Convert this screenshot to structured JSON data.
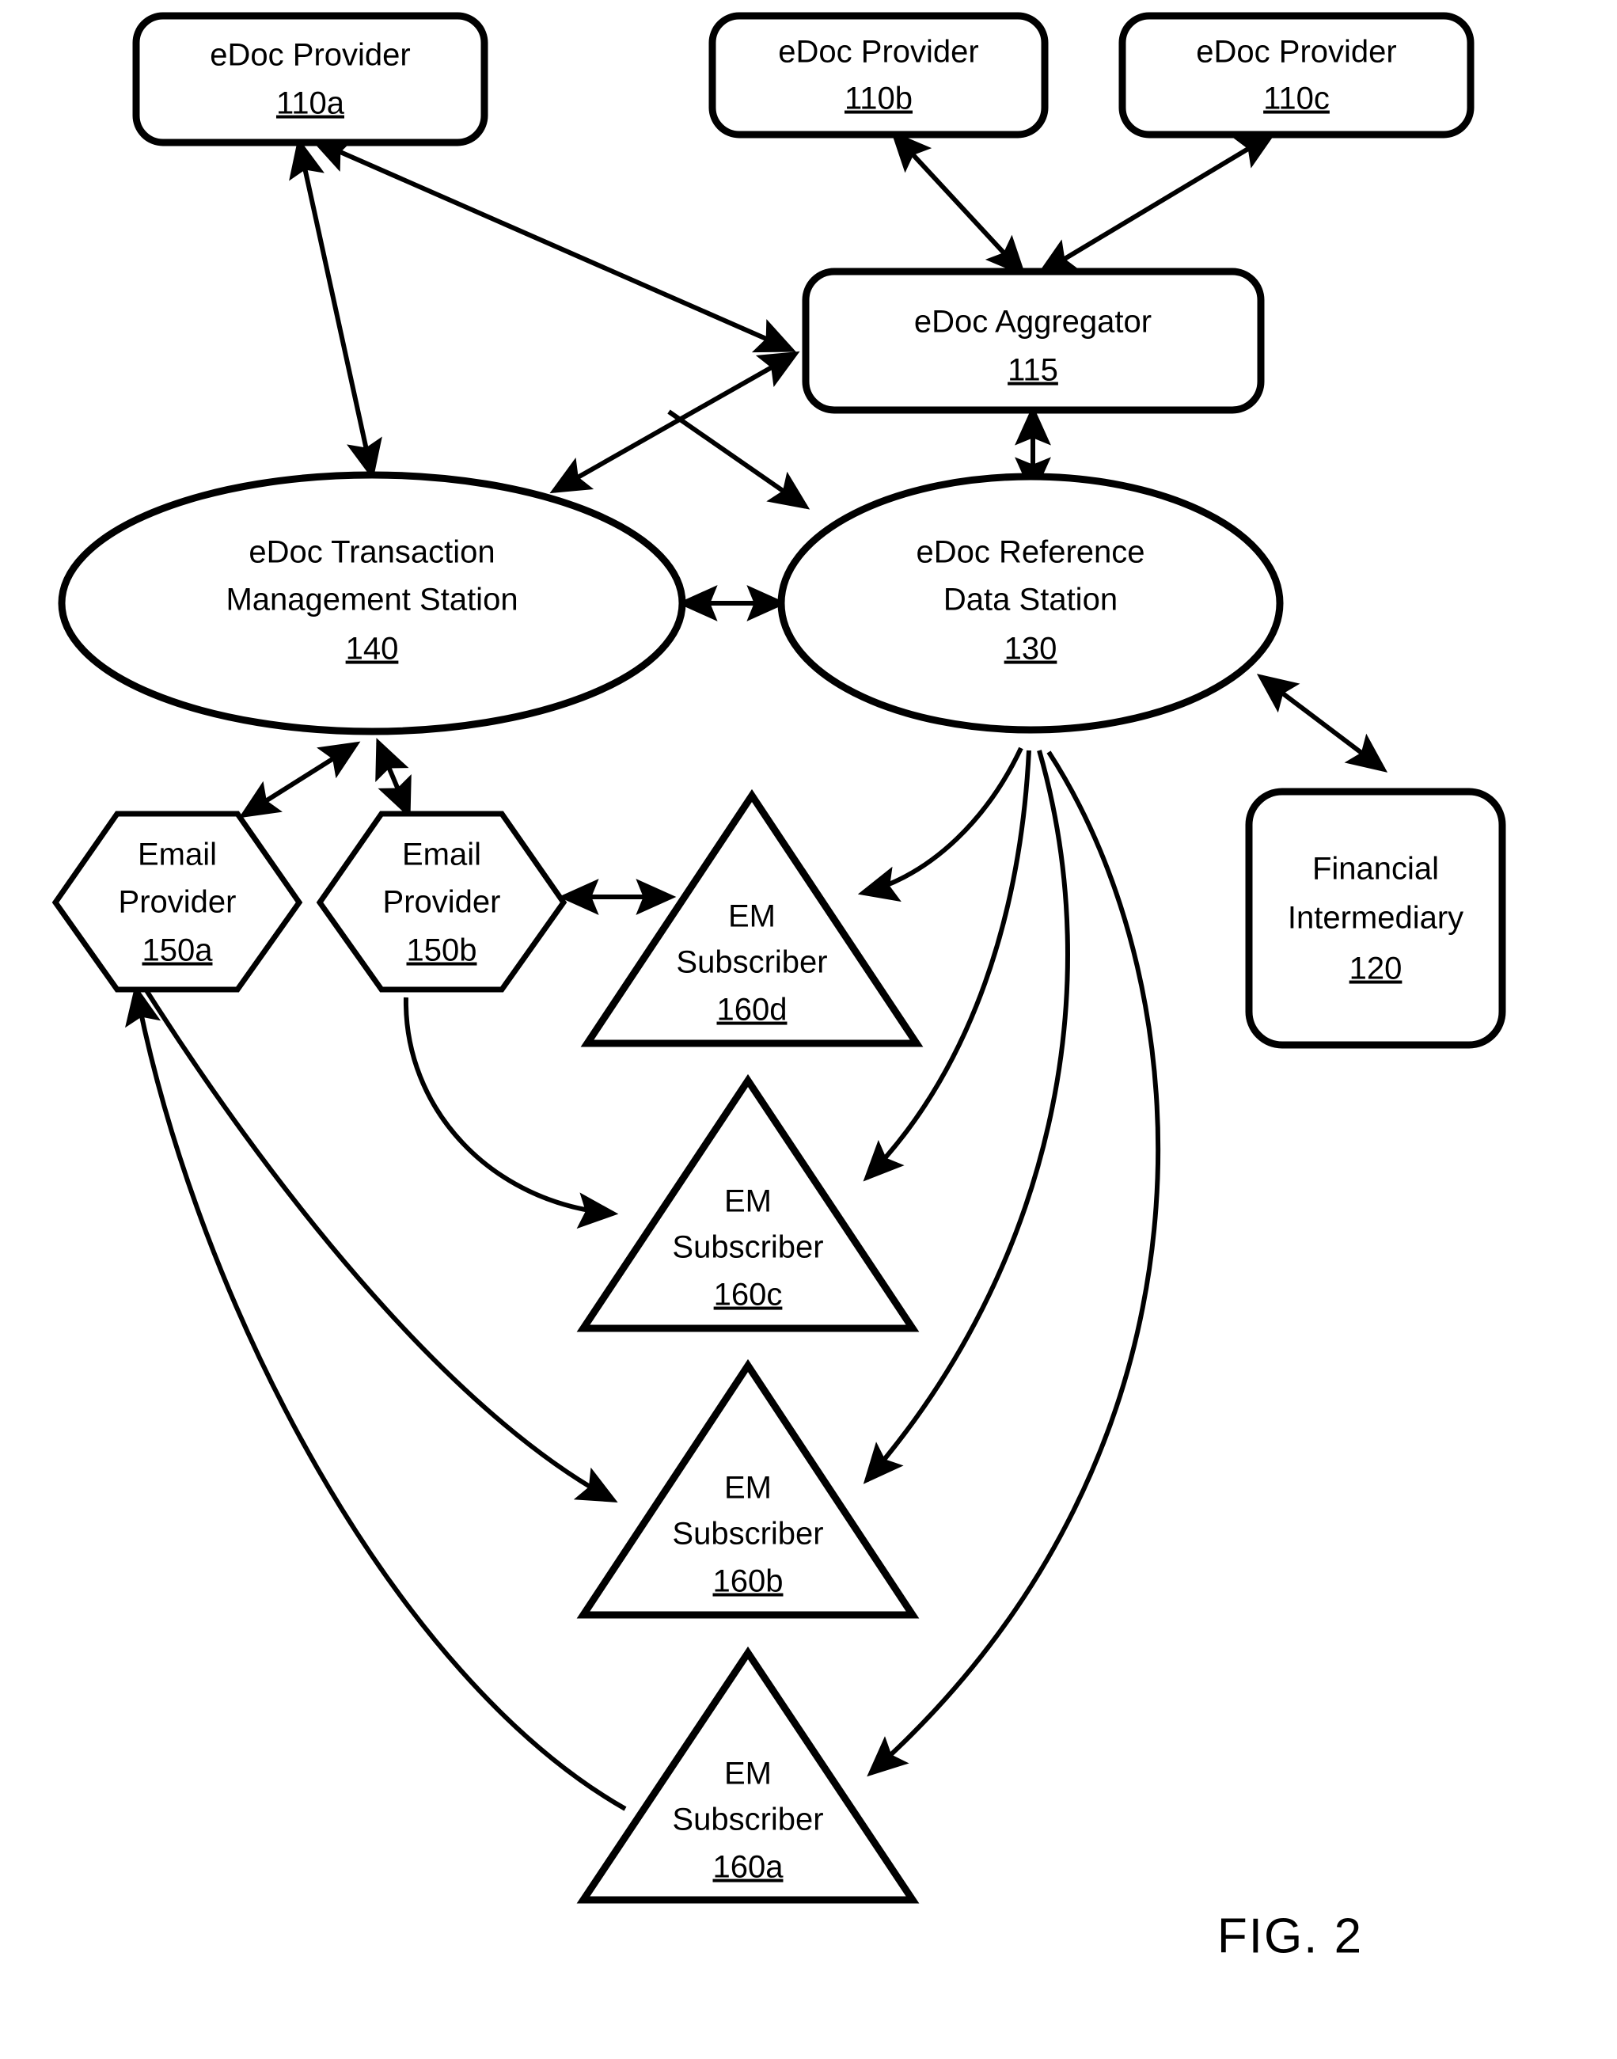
{
  "figure": {
    "caption": "FIG. 2",
    "stroke_color": "#000000",
    "background_color": "#ffffff"
  },
  "nodes": {
    "provider_a": {
      "label": "eDoc Provider",
      "ref": "110a",
      "shape": "rounded-rect"
    },
    "provider_b": {
      "label": "eDoc Provider",
      "ref": "110b",
      "shape": "rounded-rect"
    },
    "provider_c": {
      "label": "eDoc Provider",
      "ref": "110c",
      "shape": "rounded-rect"
    },
    "aggregator": {
      "label": "eDoc Aggregator",
      "ref": "115",
      "shape": "rounded-rect"
    },
    "transaction_station": {
      "label_line1": "eDoc Transaction",
      "label_line2": "Management Station",
      "ref": "140",
      "shape": "ellipse"
    },
    "reference_station": {
      "label_line1": "eDoc Reference",
      "label_line2": "Data Station",
      "ref": "130",
      "shape": "ellipse"
    },
    "financial_intermediary": {
      "label_line1": "Financial",
      "label_line2": "Intermediary",
      "ref": "120",
      "shape": "rounded-rect"
    },
    "email_provider_a": {
      "label_line1": "Email",
      "label_line2": "Provider",
      "ref": "150a",
      "shape": "hexagon"
    },
    "email_provider_b": {
      "label_line1": "Email",
      "label_line2": "Provider",
      "ref": "150b",
      "shape": "hexagon"
    },
    "subscriber_d": {
      "label_line1": "EM",
      "label_line2": "Subscriber",
      "ref": "160d",
      "shape": "triangle"
    },
    "subscriber_c": {
      "label_line1": "EM",
      "label_line2": "Subscriber",
      "ref": "160c",
      "shape": "triangle"
    },
    "subscriber_b": {
      "label_line1": "EM",
      "label_line2": "Subscriber",
      "ref": "160b",
      "shape": "triangle"
    },
    "subscriber_a": {
      "label_line1": "EM",
      "label_line2": "Subscriber",
      "ref": "160a",
      "shape": "triangle"
    }
  },
  "connections": [
    {
      "id": "c1",
      "from": "provider_a",
      "to": "transaction_station",
      "type": "bidirectional",
      "style": "straight"
    },
    {
      "id": "c2",
      "from": "provider_a",
      "to": "aggregator",
      "type": "bidirectional",
      "style": "straight"
    },
    {
      "id": "c3",
      "from": "provider_b",
      "to": "aggregator",
      "type": "bidirectional",
      "style": "straight"
    },
    {
      "id": "c4",
      "from": "provider_c",
      "to": "aggregator",
      "type": "bidirectional",
      "style": "straight"
    },
    {
      "id": "c5",
      "from": "transaction_station",
      "to": "reference_station",
      "type": "bidirectional",
      "style": "straight"
    },
    {
      "id": "c6",
      "from": "aggregator",
      "to": "reference_station",
      "type": "bidirectional",
      "style": "straight"
    },
    {
      "id": "c7",
      "from": "reference_station",
      "to": "financial_intermediary",
      "type": "bidirectional",
      "style": "straight"
    },
    {
      "id": "c8",
      "from": "transaction_station",
      "to": "email_provider_a",
      "type": "bidirectional",
      "style": "straight"
    },
    {
      "id": "c9",
      "from": "transaction_station",
      "to": "email_provider_b",
      "type": "bidirectional",
      "style": "straight"
    },
    {
      "id": "c10",
      "from": "email_provider_b",
      "to": "subscriber_d",
      "type": "bidirectional",
      "style": "straight"
    },
    {
      "id": "c11",
      "from": "reference_station",
      "to": "subscriber_d",
      "type": "unidirectional",
      "style": "curved"
    },
    {
      "id": "c12",
      "from": "reference_station",
      "to": "subscriber_c",
      "type": "unidirectional",
      "style": "curved"
    },
    {
      "id": "c13",
      "from": "reference_station",
      "to": "subscriber_b",
      "type": "unidirectional",
      "style": "curved"
    },
    {
      "id": "c14",
      "from": "reference_station",
      "to": "subscriber_a",
      "type": "unidirectional",
      "style": "curved"
    },
    {
      "id": "c15",
      "from": "email_provider_b",
      "to": "subscriber_c",
      "type": "unidirectional",
      "style": "curved"
    },
    {
      "id": "c16",
      "from": "subscriber_b",
      "to": "email_provider_a",
      "type": "unidirectional",
      "style": "curved"
    },
    {
      "id": "c17",
      "from": "subscriber_a",
      "to": "email_provider_a",
      "type": "unidirectional",
      "style": "curved"
    },
    {
      "id": "c18",
      "from": "email_provider_a",
      "to": "subscriber_b",
      "type": "unidirectional",
      "style": "curved"
    }
  ]
}
